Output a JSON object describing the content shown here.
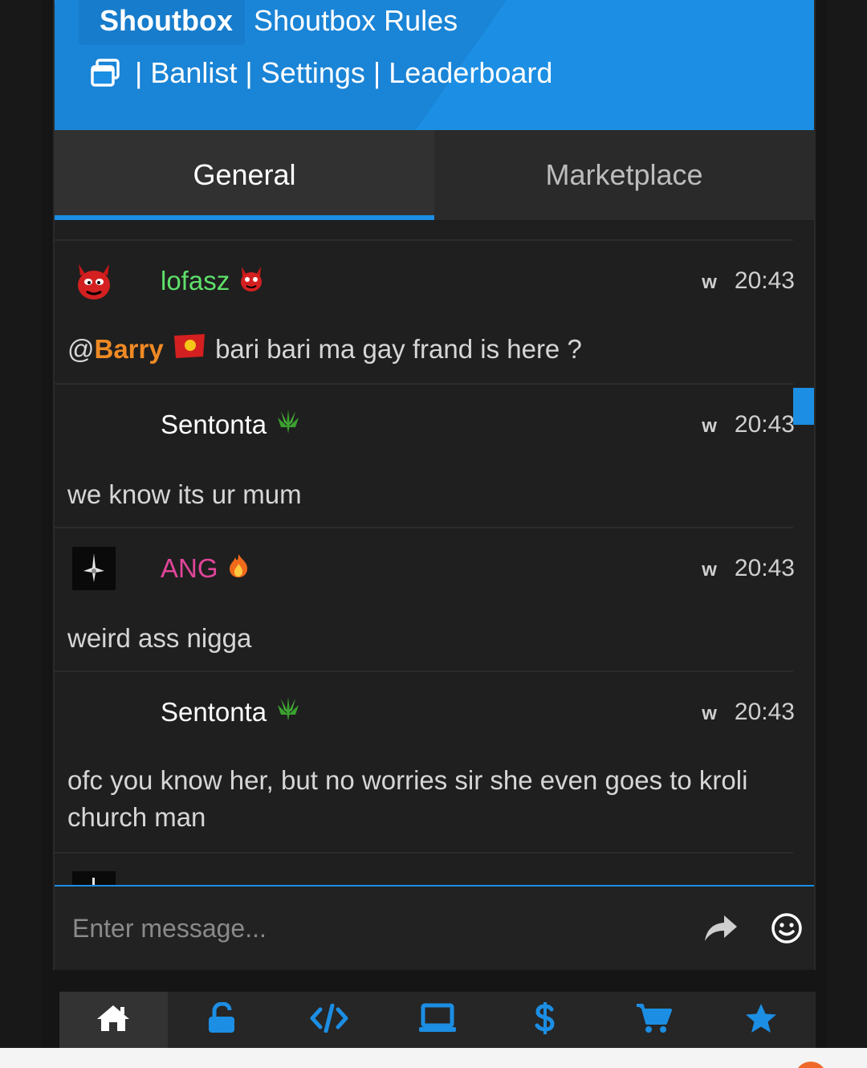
{
  "header": {
    "shoutbox_label": "Shoutbox",
    "rules_label": "Shoutbox Rules",
    "links": [
      "Banlist",
      "Settings",
      "Leaderboard"
    ],
    "separator": "|",
    "accent": "#1c8ee3"
  },
  "tabs": [
    {
      "label": "General",
      "active": true
    },
    {
      "label": "Marketplace",
      "active": false
    }
  ],
  "messages": [
    {
      "user": "lofasz",
      "user_color": "#5ee06a",
      "badge": "devil-emoji",
      "flag": "w",
      "time": "20:43",
      "mention": "@",
      "mention_name": "Barry",
      "text": "bari bari ma gay frand is here ?"
    },
    {
      "user": "Sentonta",
      "user_color": "#ffffff",
      "badge": "leaf-emoji",
      "flag": "w",
      "time": "20:43",
      "text": "we know its ur mum"
    },
    {
      "user": "ANG",
      "user_color": "#e0459a",
      "badge": "fire-emoji",
      "flag": "w",
      "time": "20:43",
      "text": "weird ass nigga"
    },
    {
      "user": "Sentonta",
      "user_color": "#ffffff",
      "badge": "leaf-emoji",
      "flag": "w",
      "time": "20:43",
      "text": "ofc you know her, but no worries sir she even goes to kroli church man"
    }
  ],
  "input": {
    "placeholder": "Enter message..."
  },
  "nav": [
    "home-icon",
    "unlock-icon",
    "code-icon",
    "laptop-icon",
    "dollar-icon",
    "cart-icon",
    "star-icon"
  ]
}
